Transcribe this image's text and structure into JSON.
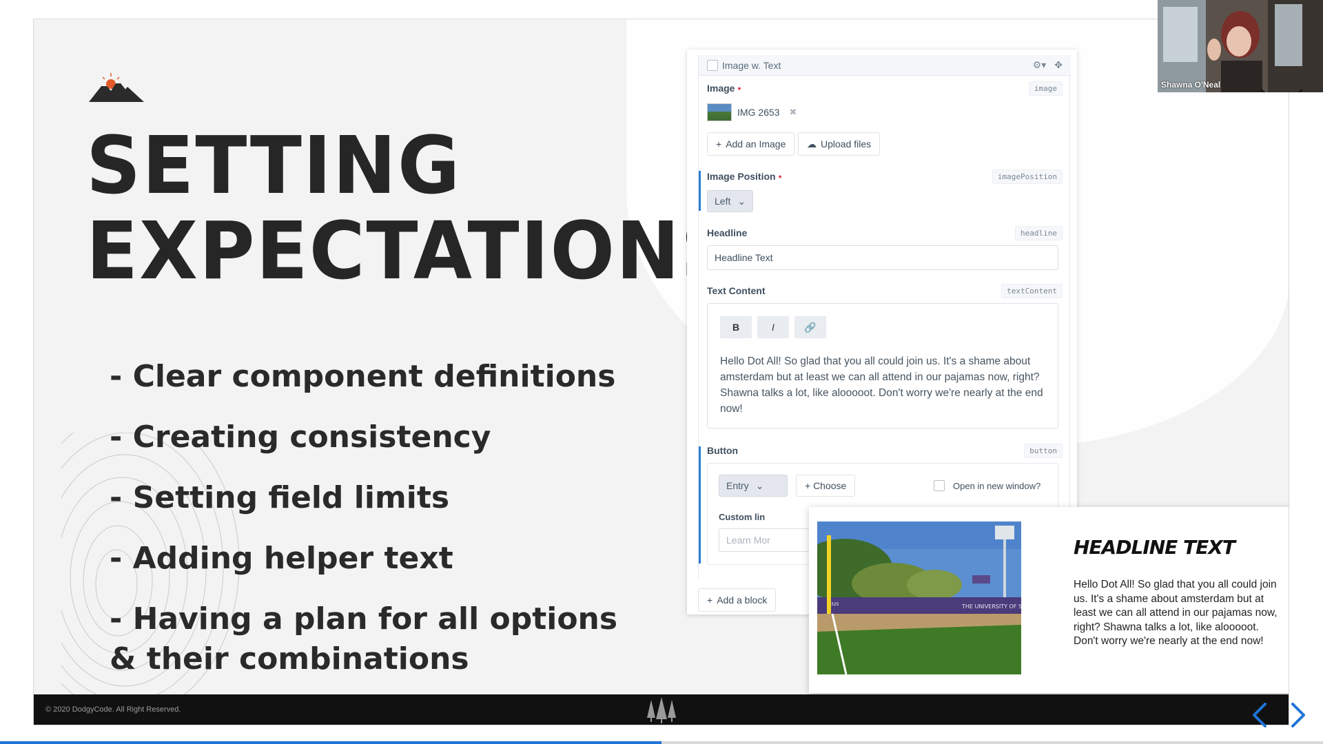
{
  "slide": {
    "title_lines": [
      "SETTING",
      "EXPECTATIONS"
    ],
    "bullets": [
      "- Clear component definitions",
      "- Creating consistency",
      "- Setting field limits",
      "- Adding helper text",
      "- Having a plan for all options & their combinations"
    ],
    "copyright": "© 2020 DodgyCode. All Right Reserved."
  },
  "cms": {
    "block_title": "Image w. Text",
    "image": {
      "label": "Image",
      "handle": "image",
      "file_name": "IMG 2653",
      "add_button": "Add an Image",
      "upload_button": "Upload files"
    },
    "image_position": {
      "label": "Image Position",
      "handle": "imagePosition",
      "value": "Left"
    },
    "headline": {
      "label": "Headline",
      "handle": "headline",
      "value": "Headline Text"
    },
    "text_content": {
      "label": "Text Content",
      "handle": "textContent",
      "bold": "B",
      "italic": "I",
      "body": "Hello Dot All! So glad that you all could join us. It's a shame about amsterdam but at least we can all attend in our pajamas now, right? Shawna talks a lot, like alooooot. Don't worry we're nearly at the end now!"
    },
    "button": {
      "label": "Button",
      "handle": "button",
      "type_value": "Entry",
      "choose": "+ Choose",
      "new_window": "Open in new window?",
      "custom_link_label": "Custom lin",
      "custom_link_placeholder": "Learn Mor"
    },
    "add_block": "Add a block"
  },
  "preview": {
    "headline": "HEADLINE TEXT",
    "body": "Hello Dot All! So glad that you all could join us. It's a shame about amsterdam but at least we can all attend in our pajamas now, right? Shawna talks a lot, like alooooot. Don't worry we're nearly at the end now!",
    "wall_text": "THE UNIVERSITY OF SCRANTON",
    "distance_marker": "325"
  },
  "webcam": {
    "name": "Shawna O'Neal"
  },
  "progress": {
    "fraction": 0.5
  },
  "colors": {
    "accent": "#2c7cd1",
    "required": "#e2425b",
    "nav_arrow": "#1f74d6"
  }
}
